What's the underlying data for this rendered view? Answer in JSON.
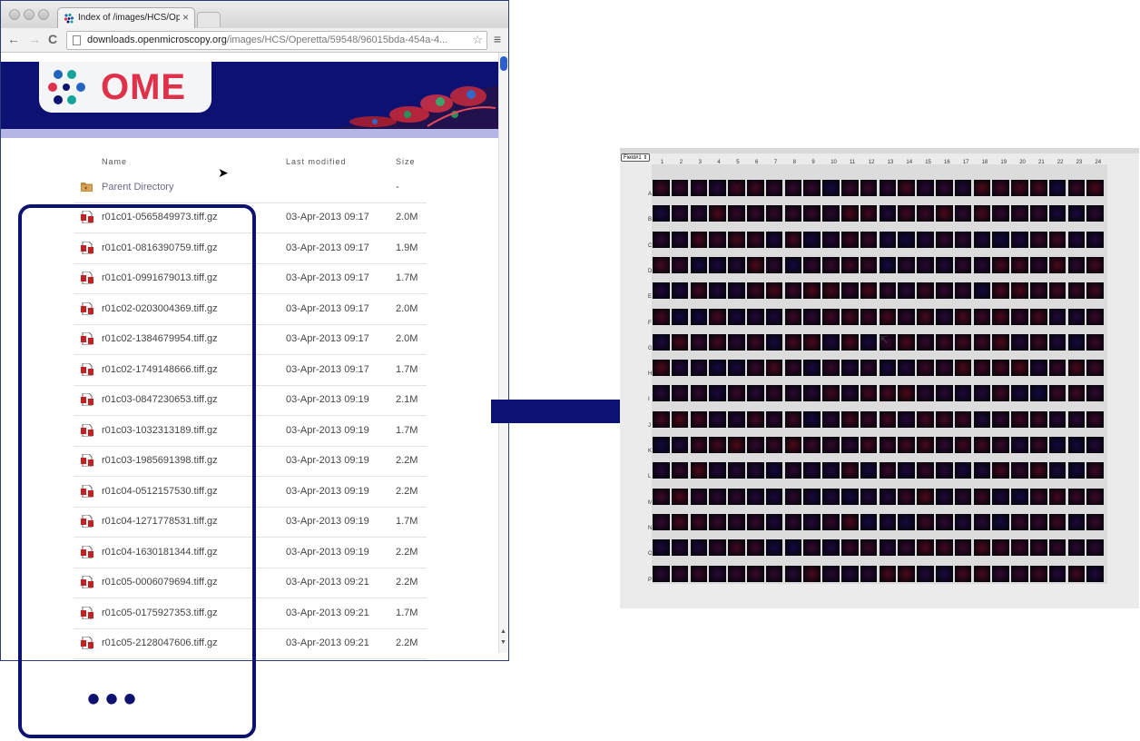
{
  "browser": {
    "tab_title": "Index of /images/HCS/Op",
    "tab_close": "×",
    "url_domain": "downloads.openmicroscopy.org",
    "url_path": "/images/HCS/Operetta/59548/96015bda-454a-4...",
    "nav_back": "←",
    "nav_forward": "→",
    "nav_reload": "C",
    "star_glyph": "☆",
    "menu_glyph": "≡"
  },
  "header": {
    "logo_text": "OME",
    "colors": {
      "navy": "#0d1171",
      "red": "#e0314a",
      "blue": "#2066c0",
      "teal": "#16a39a"
    }
  },
  "listing": {
    "col_name": "Name",
    "col_modified": "Last modified",
    "col_size": "Size",
    "parent": {
      "name": "Parent Directory",
      "date": "",
      "size": "-"
    },
    "files": [
      {
        "name": "r01c01-0565849973.tiff.gz",
        "date": "03-Apr-2013 09:17",
        "size": "2.0M"
      },
      {
        "name": "r01c01-0816390759.tiff.gz",
        "date": "03-Apr-2013 09:17",
        "size": "1.9M"
      },
      {
        "name": "r01c01-0991679013.tiff.gz",
        "date": "03-Apr-2013 09:17",
        "size": "1.7M"
      },
      {
        "name": "r01c02-0203004369.tiff.gz",
        "date": "03-Apr-2013 09:17",
        "size": "2.0M"
      },
      {
        "name": "r01c02-1384679954.tiff.gz",
        "date": "03-Apr-2013 09:17",
        "size": "2.0M"
      },
      {
        "name": "r01c02-1749148666.tiff.gz",
        "date": "03-Apr-2013 09:17",
        "size": "1.7M"
      },
      {
        "name": "r01c03-0847230653.tiff.gz",
        "date": "03-Apr-2013 09:19",
        "size": "2.1M"
      },
      {
        "name": "r01c03-1032313189.tiff.gz",
        "date": "03-Apr-2013 09:19",
        "size": "1.7M"
      },
      {
        "name": "r01c03-1985691398.tiff.gz",
        "date": "03-Apr-2013 09:19",
        "size": "2.2M"
      },
      {
        "name": "r01c04-0512157530.tiff.gz",
        "date": "03-Apr-2013 09:19",
        "size": "2.2M"
      },
      {
        "name": "r01c04-1271778531.tiff.gz",
        "date": "03-Apr-2013 09:19",
        "size": "1.7M"
      },
      {
        "name": "r01c04-1630181344.tiff.gz",
        "date": "03-Apr-2013 09:19",
        "size": "2.2M"
      },
      {
        "name": "r01c05-0006079694.tiff.gz",
        "date": "03-Apr-2013 09:21",
        "size": "2.2M"
      },
      {
        "name": "r01c05-0175927353.tiff.gz",
        "date": "03-Apr-2013 09:21",
        "size": "1.7M"
      },
      {
        "name": "r01c05-2128047606.tiff.gz",
        "date": "03-Apr-2013 09:21",
        "size": "2.2M"
      }
    ]
  },
  "annotation": {
    "ellipsis": "•••",
    "color": "#0d1171"
  },
  "plate": {
    "field_select": "Field#1 ⇕",
    "columns": [
      "1",
      "2",
      "3",
      "4",
      "5",
      "6",
      "7",
      "8",
      "9",
      "10",
      "11",
      "12",
      "13",
      "14",
      "15",
      "16",
      "17",
      "18",
      "19",
      "20",
      "21",
      "22",
      "23",
      "24"
    ],
    "rows": [
      "A",
      "B",
      "C",
      "D",
      "E",
      "F",
      "G",
      "H",
      "I",
      "J",
      "K",
      "L",
      "M",
      "N",
      "O",
      "P"
    ]
  }
}
